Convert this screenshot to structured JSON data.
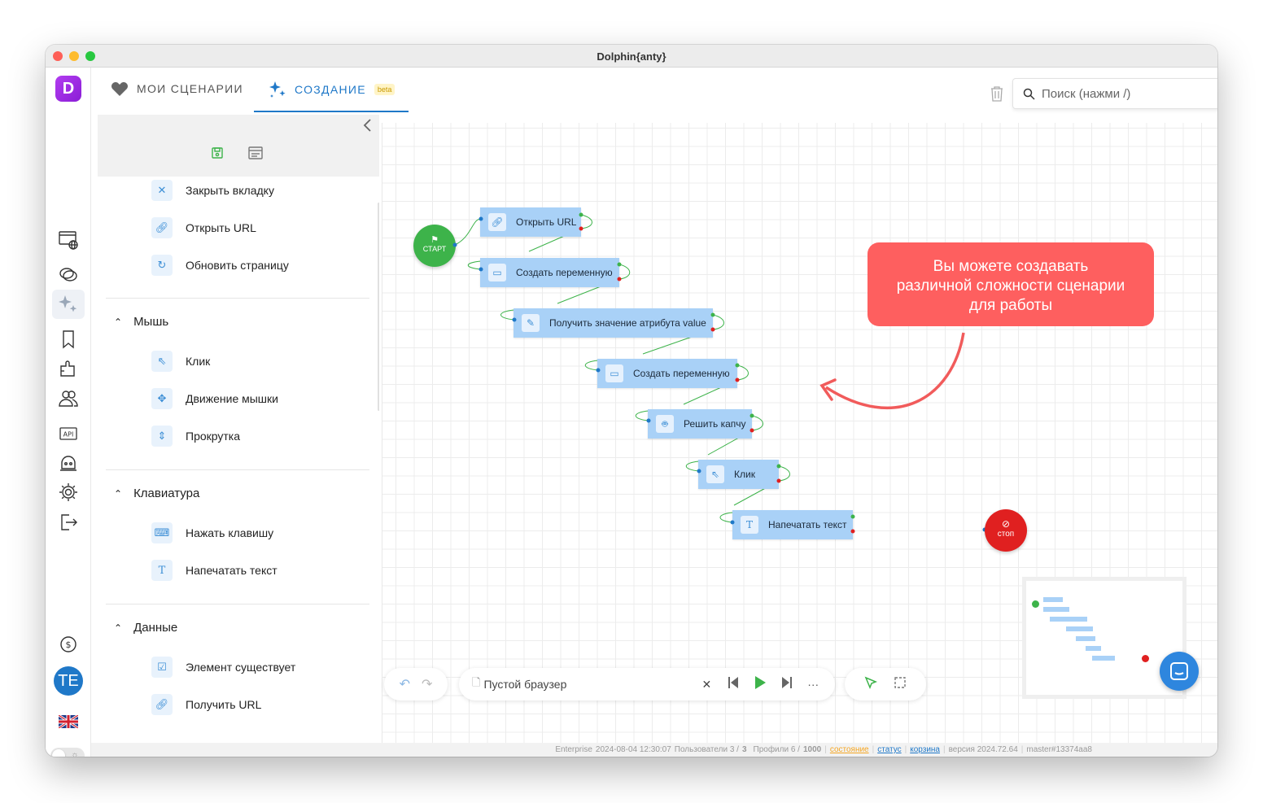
{
  "window": {
    "title": "Dolphin{anty}"
  },
  "rail": {
    "logo_letter": "D",
    "avatar_initials": "TE"
  },
  "tabs": {
    "my_scenarios": "МОИ СЦЕНАРИИ",
    "create": "СОЗДАНИЕ",
    "beta": "beta"
  },
  "search": {
    "placeholder": "Поиск (нажми /)"
  },
  "left_panel": {
    "items_top": [
      "Закрыть вкладку",
      "Открыть URL",
      "Обновить страницу"
    ],
    "sections": [
      {
        "title": "Мышь",
        "items": [
          "Клик",
          "Движение мышки",
          "Прокрутка"
        ]
      },
      {
        "title": "Клавиатура",
        "items": [
          "Нажать клавишу",
          "Напечатать текст"
        ]
      },
      {
        "title": "Данные",
        "items": [
          "Элемент существует",
          "Получить URL"
        ]
      }
    ]
  },
  "canvas": {
    "start_label": "СТАРТ",
    "stop_label": "стоп",
    "nodes": [
      "Открыть URL",
      "Создать переменную",
      "Получить значение атрибута value",
      "Создать переменную",
      "Решить капчу",
      "Клик",
      "Напечатать текст"
    ],
    "callout": [
      "Вы можете создавать",
      "различной сложности сценарии",
      "для работы"
    ]
  },
  "toolbar": {
    "browser_label": "Пустой браузер",
    "more": "···"
  },
  "statusbar": {
    "plan": "Enterprise",
    "datetime": "2024-08-04 12:30:07",
    "users_label": "Пользователи 3 /",
    "users_max": "3",
    "profiles_label": "Профили 6 /",
    "profiles_max": "1000",
    "link_state": "состояние",
    "link_status": "статус",
    "link_cart": "корзина",
    "version": "версия 2024.72.64",
    "build": "master#13374aa8"
  },
  "colors": {
    "accent": "#1f78c8",
    "node": "#a9d1f7",
    "start": "#3db34a",
    "stop": "#e02020",
    "callout": "#fe5f5f"
  }
}
